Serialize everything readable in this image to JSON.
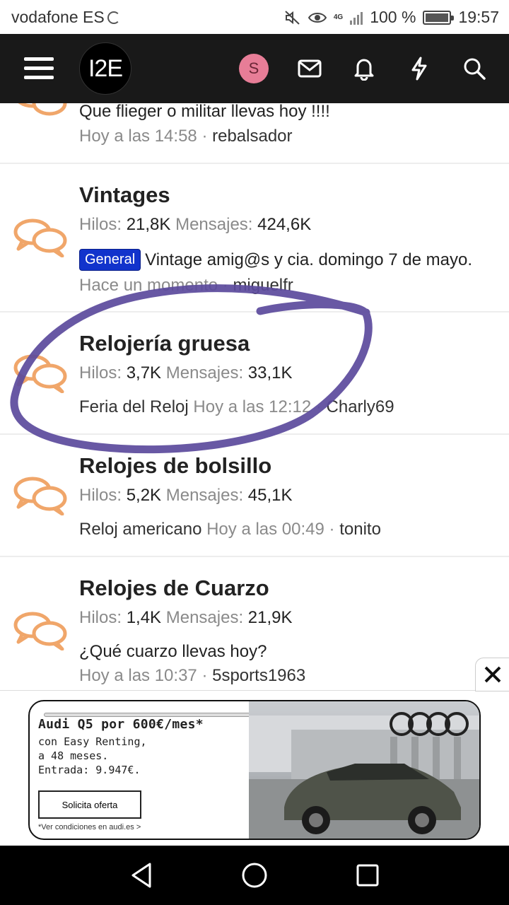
{
  "status_bar": {
    "carrier": "vodafone ES",
    "network": "4G",
    "battery": "100 %",
    "time": "19:57"
  },
  "navbar": {
    "logo_text": "I2E",
    "avatar_letter": "S",
    "icons": [
      "menu-icon",
      "mail-icon",
      "bell-icon",
      "lightning-icon",
      "search-icon"
    ]
  },
  "forums": [
    {
      "title": "",
      "latest_thread": "Que flieger o militar llevas hoy !!!!",
      "latest_time": "Hoy a las 14:58",
      "latest_user": "rebalsador"
    },
    {
      "title": "Vintages",
      "threads_label": "Hilos:",
      "threads": "21,8K",
      "messages_label": "Mensajes:",
      "messages": "424,6K",
      "prefix": "General",
      "latest_thread": "Vintage amig@s y cia. domingo 7 de mayo.",
      "latest_time": "Hace un momento",
      "latest_user": "miguelfr"
    },
    {
      "title": "Relojería gruesa",
      "threads_label": "Hilos:",
      "threads": "3,7K",
      "messages_label": "Mensajes:",
      "messages": "33,1K",
      "latest_thread": "Feria del Reloj",
      "latest_time": "Hoy a las 12:12",
      "latest_user": "Charly69"
    },
    {
      "title": "Relojes de bolsillo",
      "threads_label": "Hilos:",
      "threads": "5,2K",
      "messages_label": "Mensajes:",
      "messages": "45,1K",
      "latest_thread": "Reloj americano",
      "latest_time": "Hoy a las 00:49",
      "latest_user": "tonito"
    },
    {
      "title": "Relojes de Cuarzo",
      "threads_label": "Hilos:",
      "threads": "1,4K",
      "messages_label": "Mensajes:",
      "messages": "21,9K",
      "latest_thread": "¿Qué cuarzo llevas hoy?",
      "latest_time": "Hoy a las 10:37",
      "latest_user": "5sports1963"
    }
  ],
  "ad": {
    "headline": "Audi Q5 por 600€/mes*",
    "line1": "con Easy Renting,",
    "line2": "a 48 meses.",
    "line3": "Entrada: 9.947€.",
    "cta": "Solicita oferta",
    "footnote": "*Ver condiciones en audi.es >",
    "colors": {
      "border": "#111111",
      "sky": "#c9ccd0",
      "car": "#4f5349"
    }
  },
  "annotation": {
    "color": "#5b4a9c"
  },
  "colors": {
    "navbar": "#191919",
    "forum_icon": "#f0a66a",
    "label_general": "#1133cc",
    "muted": "#8a8a8a"
  }
}
